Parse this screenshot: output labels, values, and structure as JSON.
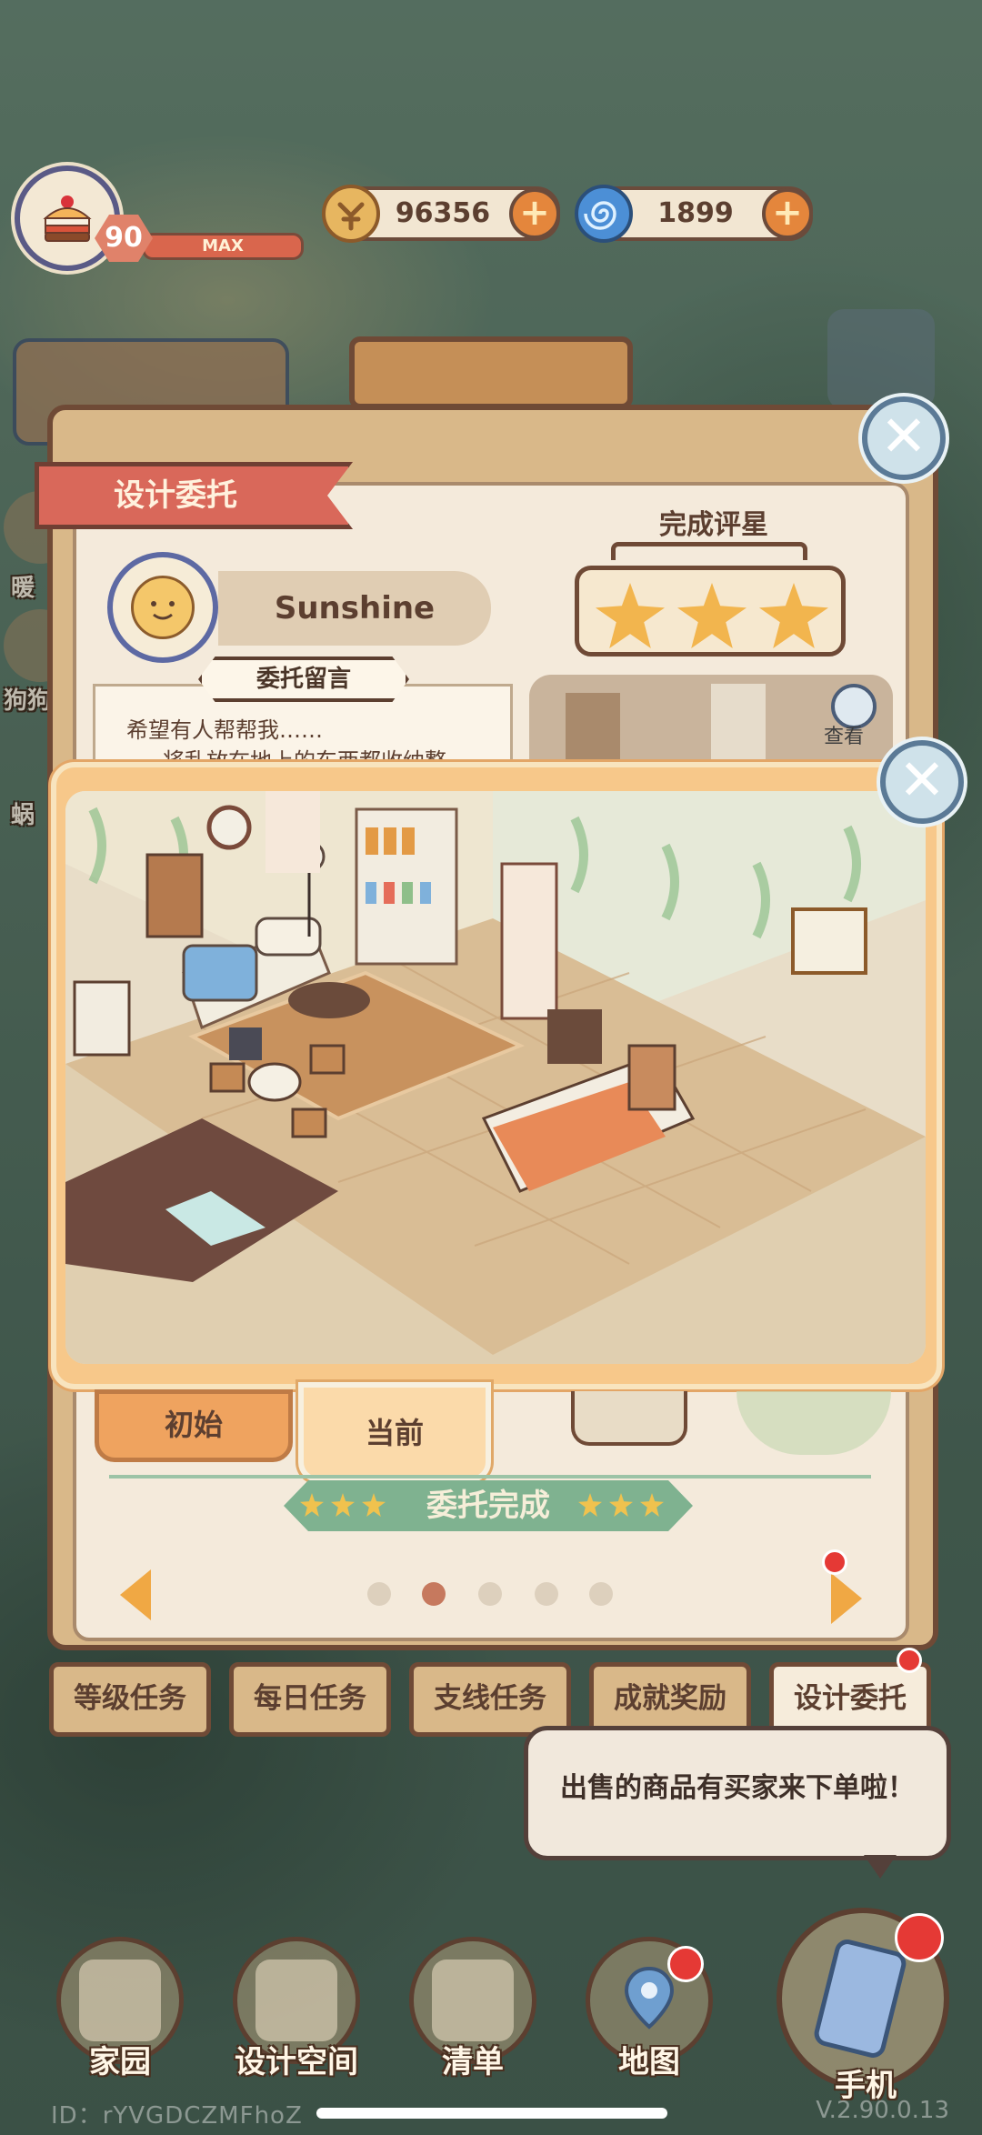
{
  "hud": {
    "level": "90",
    "level_bar_label": "MAX",
    "coins": "96356",
    "gems": "1899",
    "plus": "+"
  },
  "side_labels": [
    "暖",
    "狗狗",
    "蜗"
  ],
  "commission": {
    "ribbon_title": "设计委托",
    "client_name": "Sunshine",
    "message_title": "委托留言",
    "message_lines": [
      "希望有人帮帮我……",
      "将乱放在地上的东西都收纳整"
    ],
    "rating_title": "完成评星",
    "stars": 3,
    "look_label": "查看"
  },
  "popup": {
    "close": "✕"
  },
  "tabs": {
    "initial": "初始",
    "current": "当前"
  },
  "status_band": "委托完成",
  "pager": {
    "count": 5,
    "active_index": 1
  },
  "bottom_tabs": [
    "等级任务",
    "每日任务",
    "支线任务",
    "成就奖励",
    "设计委托"
  ],
  "bubble_text": "出售的商品有买家来下单啦！",
  "nav": {
    "home": "家园",
    "design": "设计空间",
    "list": "清单",
    "map": "地图",
    "phone": "手机"
  },
  "footer": {
    "id": "ID：rYVGDCZMFhoZ",
    "version": "V.2.90.0.13"
  },
  "colors": {
    "panel": "#d9b889",
    "accent": "#f0a844",
    "ribbon": "#d9685a",
    "badge": "#e53935",
    "status_band": "#7fb290"
  }
}
